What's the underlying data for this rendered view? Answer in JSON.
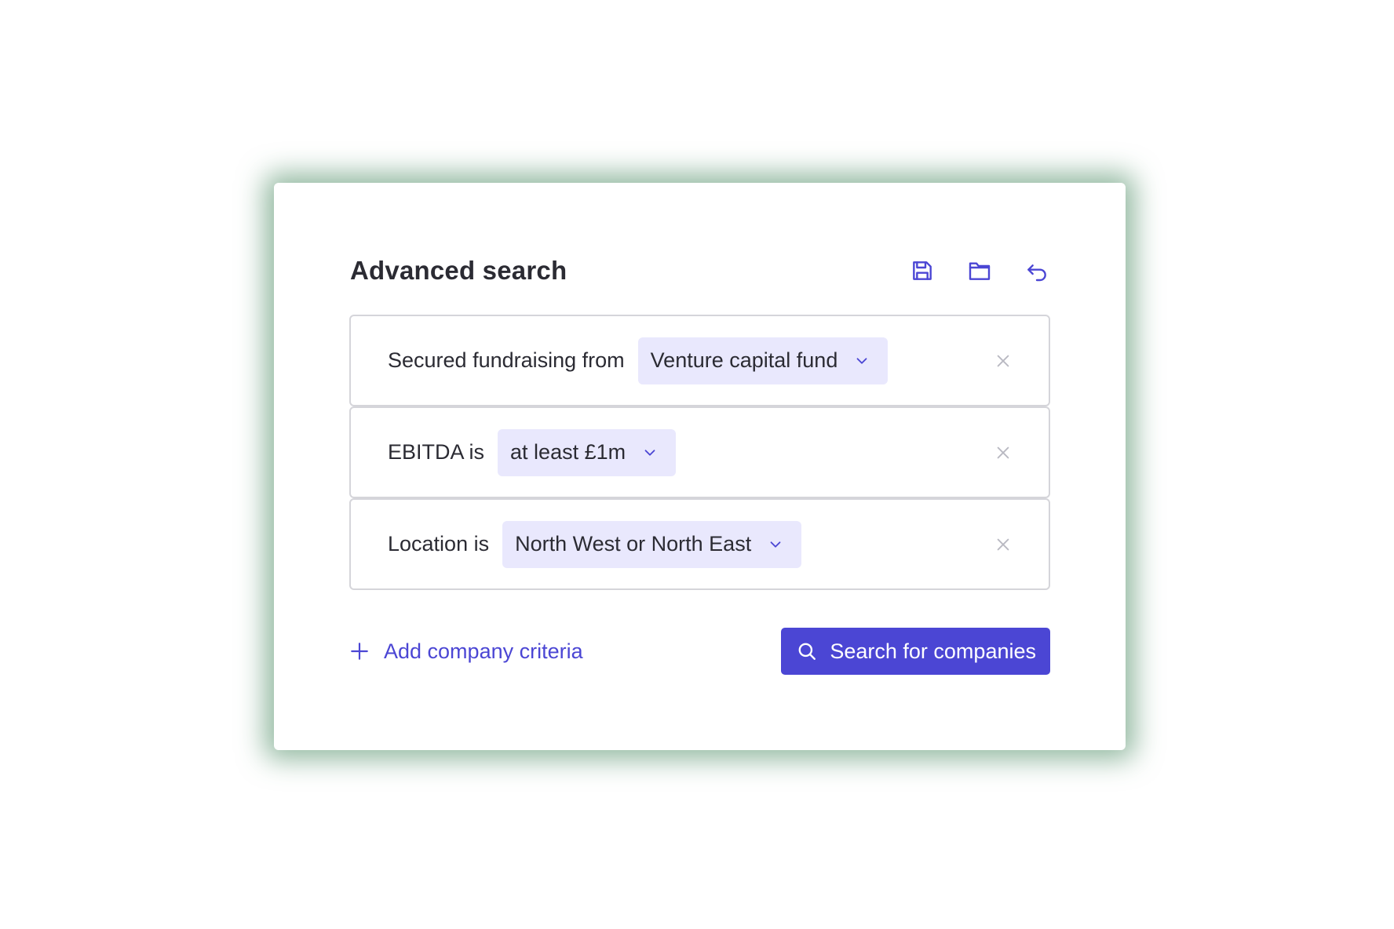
{
  "panel": {
    "title": "Advanced search",
    "header_icons": [
      {
        "name": "save-icon"
      },
      {
        "name": "folder-icon"
      },
      {
        "name": "undo-icon"
      }
    ]
  },
  "criteria": [
    {
      "label": "Secured fundraising from",
      "value": "Venture capital fund"
    },
    {
      "label": "EBITDA is",
      "value": "at least £1m"
    },
    {
      "label": "Location is",
      "value": "North West or North East"
    }
  ],
  "actions": {
    "add_label": "Add company criteria",
    "search_label": "Search for companies"
  },
  "colors": {
    "accent": "#4b46d4",
    "dropdown_bg": "#e9e8fd",
    "text": "#2b2b33",
    "border": "#d5d5da",
    "shadow": "#3a8054"
  }
}
